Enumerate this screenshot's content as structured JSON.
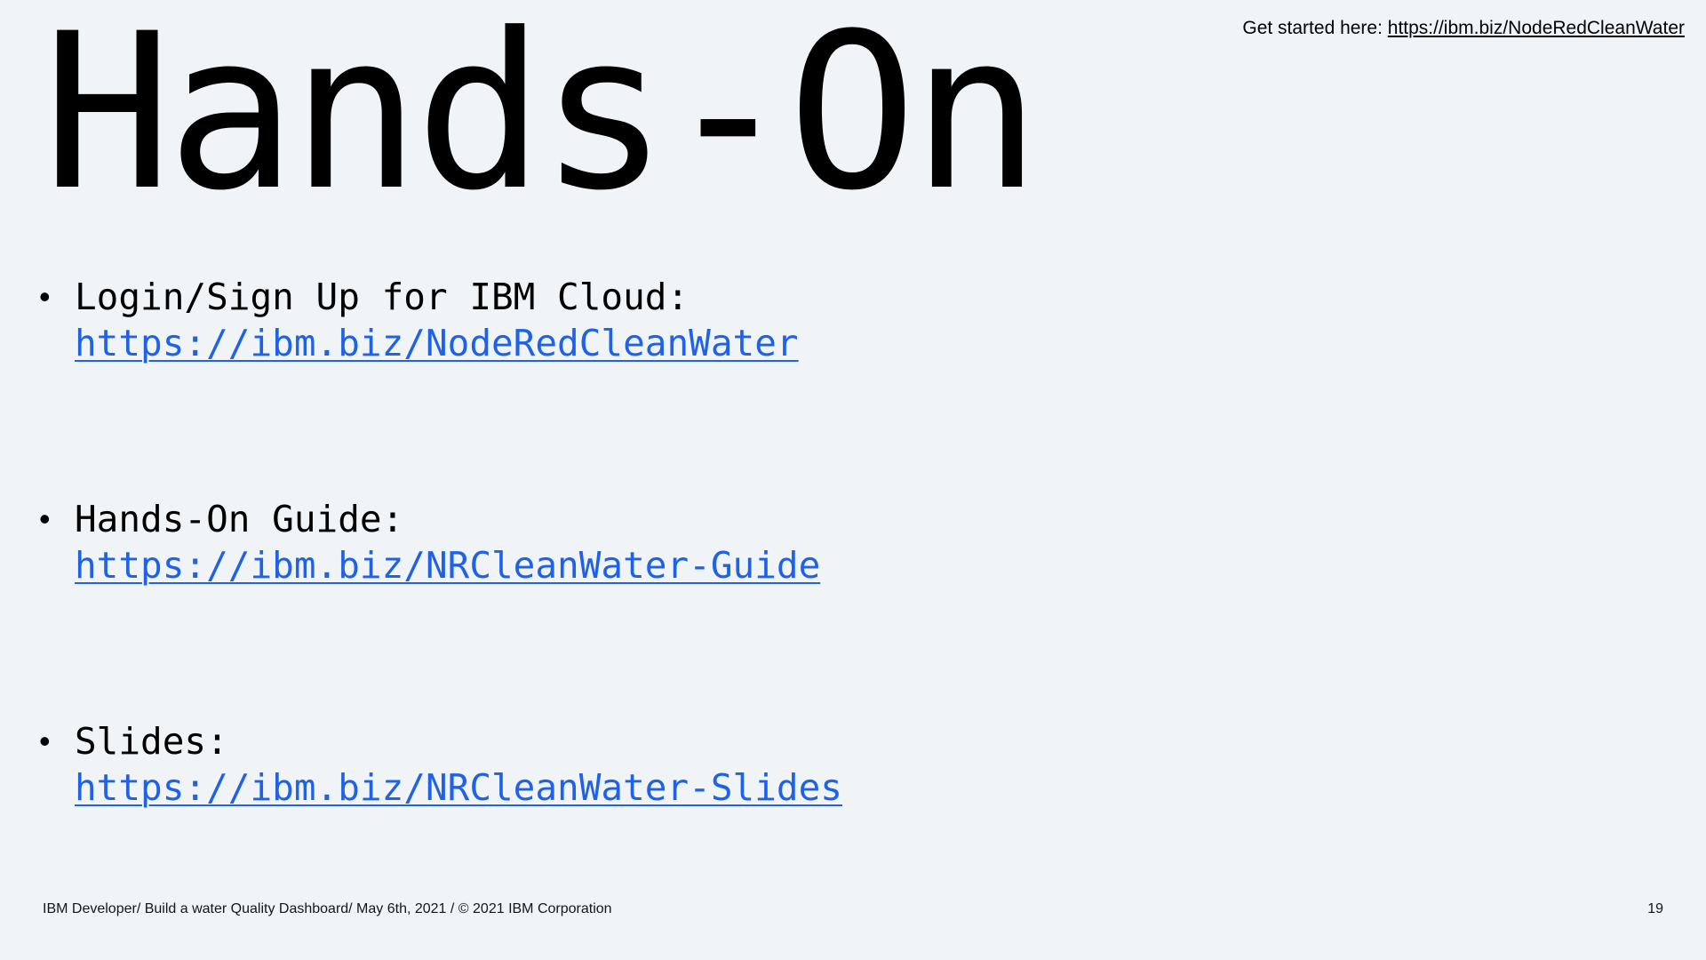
{
  "header": {
    "note_prefix": "Get started here: ",
    "note_link": "https://ibm.biz/NodeRedCleanWater"
  },
  "title": "Hands-On",
  "bullets": [
    {
      "label": "Login/Sign Up for IBM Cloud:",
      "link": "https://ibm.biz/NodeRedCleanWater"
    },
    {
      "label": "Hands-On Guide:",
      "link": "https://ibm.biz/NRCleanWater-Guide"
    },
    {
      "label": "Slides:",
      "link": "https://ibm.biz/NRCleanWater-Slides"
    }
  ],
  "bullet_symbol": "•",
  "footer": {
    "text": "IBM Developer/ Build a water Quality Dashboard/ May 6th, 2021 / © 2021 IBM Corporation",
    "page_number": "19"
  },
  "colors": {
    "background": "#f0f4f7",
    "link": "#1f62e8",
    "text": "#000000"
  }
}
